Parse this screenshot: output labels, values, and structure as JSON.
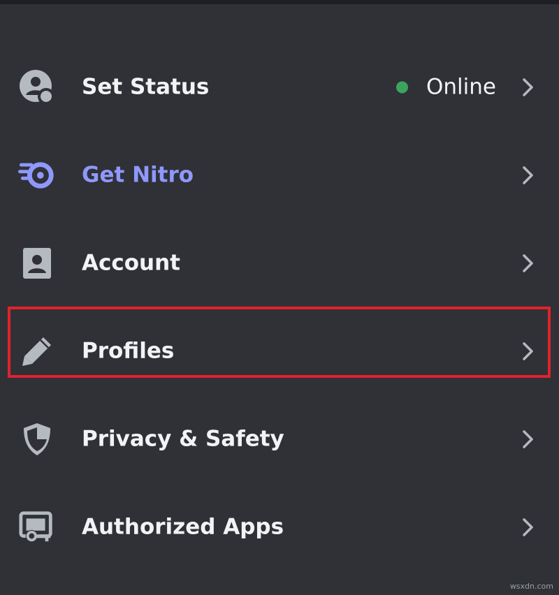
{
  "menu": {
    "items": [
      {
        "label": "Set Status",
        "icon": "user-status-icon",
        "status": "Online",
        "status_color": "#3ba55d"
      },
      {
        "label": "Get Nitro",
        "icon": "nitro-icon",
        "color": "#8f98ff"
      },
      {
        "label": "Account",
        "icon": "account-icon"
      },
      {
        "label": "Profiles",
        "icon": "pencil-icon",
        "highlighted": true
      },
      {
        "label": "Privacy & Safety",
        "icon": "shield-icon"
      },
      {
        "label": "Authorized Apps",
        "icon": "authorized-apps-icon"
      }
    ]
  },
  "watermark": "wsxdn.com",
  "colors": {
    "background": "#2f3136",
    "text": "#f2f3f5",
    "icon": "#b5bac1",
    "nitro": "#8f98ff",
    "online": "#3ba55d",
    "highlight": "#e0222d"
  }
}
